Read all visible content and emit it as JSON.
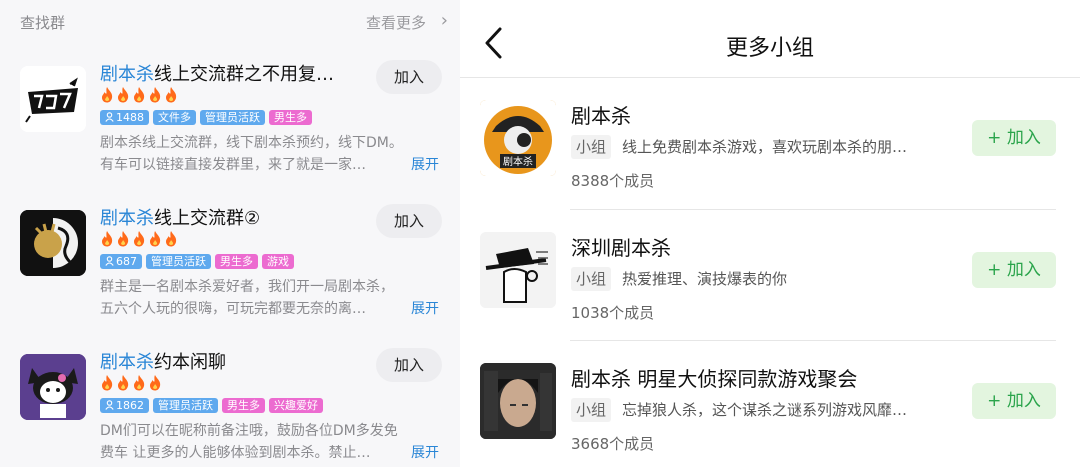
{
  "left": {
    "header": {
      "title": "查找群",
      "more": "查看更多"
    },
    "groups": [
      {
        "title_highlight": "剧本杀",
        "title_rest": "线上交流群之不用复…",
        "flames": 5,
        "tags": [
          {
            "text": "1488",
            "color": "blue",
            "icon": "person-icon"
          },
          {
            "text": "文件多",
            "color": "blue"
          },
          {
            "text": "管理员活跃",
            "color": "blue"
          },
          {
            "text": "男生多",
            "color": "pink"
          }
        ],
        "desc": [
          "剧本杀线上交流群，线下剧本杀预约，线下DM。",
          "有车可以链接直接发群里，来了就是一家…"
        ],
        "expand": "展开",
        "join": "加入"
      },
      {
        "title_highlight": "剧本杀",
        "title_rest": "线上交流群②",
        "flames": 5,
        "tags": [
          {
            "text": "687",
            "color": "blue",
            "icon": "person-icon"
          },
          {
            "text": "管理员活跃",
            "color": "blue"
          },
          {
            "text": "男生多",
            "color": "pink"
          },
          {
            "text": "游戏",
            "color": "pink"
          }
        ],
        "desc": [
          "群主是一名剧本杀爱好者，我们开一局剧本杀，",
          "五六个人玩的很嗨，可玩完都要无奈的离…"
        ],
        "expand": "展开",
        "join": "加入"
      },
      {
        "title_highlight": "剧本杀",
        "title_rest": "约本闲聊",
        "flames": 4,
        "tags": [
          {
            "text": "1862",
            "color": "blue",
            "icon": "person-icon"
          },
          {
            "text": "管理员活跃",
            "color": "blue"
          },
          {
            "text": "男生多",
            "color": "pink"
          },
          {
            "text": "兴趣爱好",
            "color": "pink"
          }
        ],
        "desc": [
          "DM们可以在昵称前备注哦，鼓励各位DM多发免",
          "费车 让更多的人能够体验到剧本杀。禁止…"
        ],
        "expand": "展开",
        "join": "加入"
      }
    ]
  },
  "right": {
    "nav_title": "更多小组",
    "items": [
      {
        "title": "剧本杀",
        "badge": "小组",
        "desc": "线上免费剧本杀游戏，喜欢玩剧本杀的朋…",
        "members": "8388个成员",
        "join": "+ 加入"
      },
      {
        "title": "深圳剧本杀",
        "badge": "小组",
        "desc": "热爱推理、演技爆表的你",
        "members": "1038个成员",
        "join": "+ 加入"
      },
      {
        "title": "剧本杀 明星大侦探同款游戏聚会",
        "badge": "小组",
        "desc": "忘掉狼人杀，这个谋杀之谜系列游戏风靡…",
        "members": "3668个成员",
        "join": "+ 加入"
      }
    ]
  },
  "colors": {
    "link_blue": "#2a86d6",
    "tag_blue": "#5fa9ee",
    "tag_pink": "#ec6bd0",
    "join_green": "#2aa44b",
    "flame": "#ff6a1a"
  }
}
